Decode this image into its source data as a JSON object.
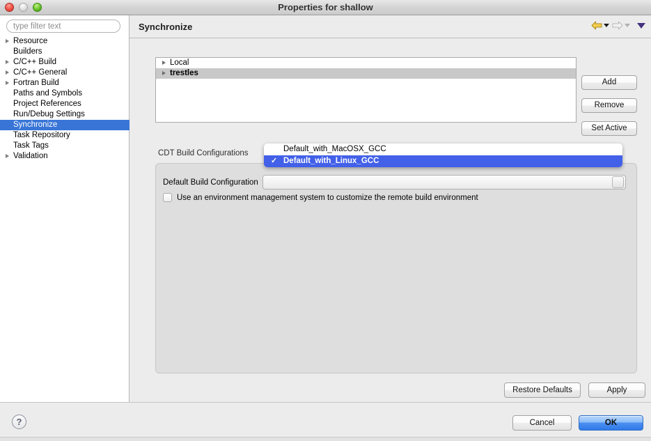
{
  "window": {
    "title": "Properties for shallow",
    "traffic_lights": [
      "close",
      "minimize",
      "zoom"
    ]
  },
  "sidebar": {
    "filter": {
      "value": "",
      "placeholder": "type filter text"
    },
    "items": [
      {
        "label": "Resource",
        "expandable": true,
        "selected": false
      },
      {
        "label": "Builders",
        "expandable": false,
        "selected": false
      },
      {
        "label": "C/C++ Build",
        "expandable": true,
        "selected": false
      },
      {
        "label": "C/C++ General",
        "expandable": true,
        "selected": false
      },
      {
        "label": "Fortran Build",
        "expandable": true,
        "selected": false
      },
      {
        "label": "Paths and Symbols",
        "expandable": false,
        "selected": false
      },
      {
        "label": "Project References",
        "expandable": false,
        "selected": false
      },
      {
        "label": "Run/Debug Settings",
        "expandable": false,
        "selected": false
      },
      {
        "label": "Synchronize",
        "expandable": false,
        "selected": true
      },
      {
        "label": "Task Repository",
        "expandable": false,
        "selected": false
      },
      {
        "label": "Task Tags",
        "expandable": false,
        "selected": false
      },
      {
        "label": "Validation",
        "expandable": true,
        "selected": false
      }
    ],
    "help_label": "?"
  },
  "page": {
    "title": "Synchronize",
    "nav": {
      "back_icon": "back-arrow-icon",
      "forward_icon": "forward-arrow-icon",
      "menu_icon": "view-menu-chevron-icon"
    }
  },
  "providers": {
    "rows": [
      {
        "label": "Local",
        "selected": false
      },
      {
        "label": "trestles",
        "selected": true
      }
    ],
    "buttons": {
      "add": "Add",
      "remove": "Remove",
      "set_active": "Set Active"
    }
  },
  "build_group": {
    "legend": "CDT Build Configurations",
    "default_config_label": "Default Build Configuration",
    "default_config_value": "Default_with_Linux_GCC",
    "env_checkbox": {
      "label": "Use an environment management system to customize the remote build environment",
      "checked": false
    }
  },
  "dropdown": {
    "open": true,
    "options": [
      {
        "label": "Default_with_MacOSX_GCC",
        "selected": false,
        "check": ""
      },
      {
        "label": "Default_with_Linux_GCC",
        "selected": true,
        "check": "✓"
      }
    ]
  },
  "footer": {
    "restore_defaults": "Restore Defaults",
    "apply": "Apply",
    "cancel": "Cancel",
    "ok": "OK"
  },
  "colors": {
    "selection_blue": "#3875d7",
    "dropdown_blue": "#4260e8",
    "default_button_blue": "#2f79e8",
    "row_selection_gray": "#c8c8c8",
    "window_bg": "#ececec",
    "group_bg": "#dedede"
  }
}
